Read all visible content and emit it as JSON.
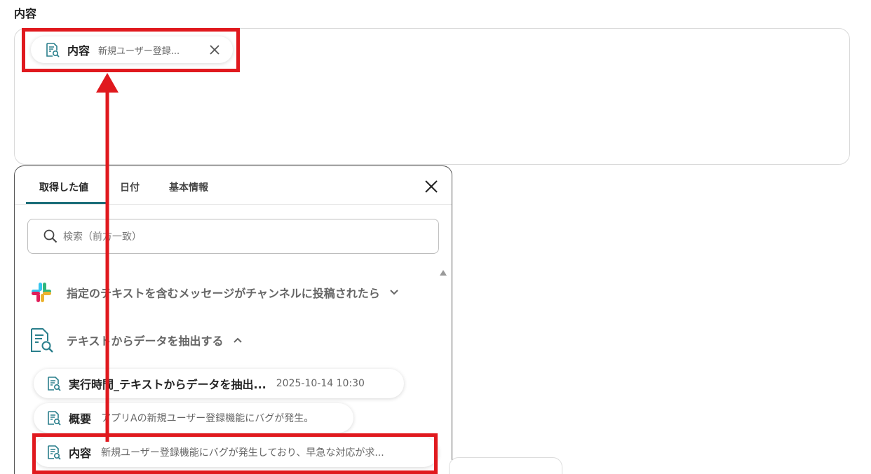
{
  "field": {
    "label": "内容",
    "selected_chip": {
      "label": "内容",
      "value": "新規ユーザー登録..."
    }
  },
  "popup": {
    "tabs": [
      {
        "label": "取得した値"
      },
      {
        "label": "日付"
      },
      {
        "label": "基本情報"
      }
    ],
    "search_placeholder": "検索（前方一致）",
    "sections": [
      {
        "title": "指定のテキストを含むメッセージがチャンネルに投稿されたら",
        "expanded": false
      },
      {
        "title": "テキストからデータを抽出する",
        "expanded": true
      }
    ],
    "items": [
      {
        "label": "実行時間_テキストからデータを抽出...",
        "value": "2025-10-14 10:30"
      },
      {
        "label": "概要",
        "value": "アプリAの新規ユーザー登録機能にバグが発生。"
      },
      {
        "label": "内容",
        "value": "新規ユーザー登録機能にバグが発生しており、早急な対応が求..."
      }
    ]
  },
  "colors": {
    "accent": "#1d6f7a",
    "highlight": "#e0191e"
  }
}
